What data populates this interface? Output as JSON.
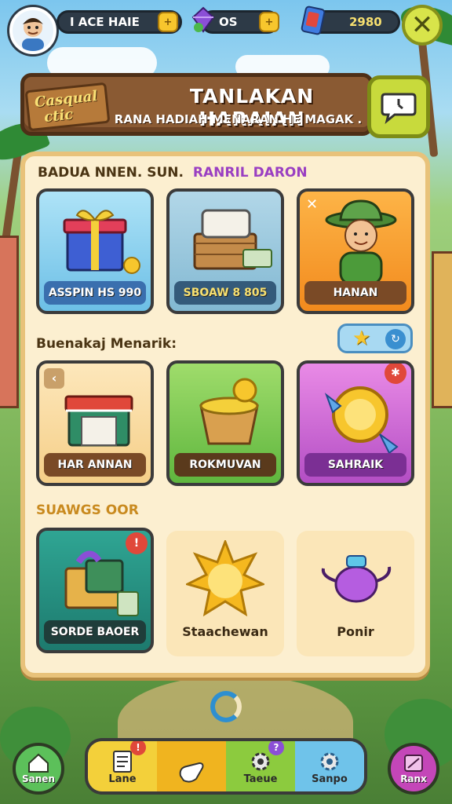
{
  "header": {
    "player_name": "I ACE HAIE",
    "gems": "OS",
    "currency": "2980",
    "coin_add_symbol": "+",
    "close_symbol": "✕"
  },
  "banner": {
    "logo_line1": "Casqual",
    "logo_line2": "ctic",
    "title": "TANLAKAN HARAIAN",
    "subtitle": "RANA HADIAH MENARAN HE MAGAK ."
  },
  "sections": {
    "daily_title_a": "BADUA NNEN. SUN.",
    "daily_title_b": "RANRIL DARON",
    "special_title": "Buenakaj Menarik:",
    "other_title": "SUAWGS OOR"
  },
  "cards_row1": [
    {
      "label": "ASSPIN HS 990"
    },
    {
      "label": "SBOAW 8 805"
    },
    {
      "label": "HANAN"
    }
  ],
  "cards_row2": [
    {
      "label": "HAR ANNAN"
    },
    {
      "label": "ROKMUVAN"
    },
    {
      "label": "SAHRAIK"
    }
  ],
  "cards_row3": [
    {
      "label": "SORDE BAOER",
      "badge": "!"
    },
    {
      "label": "Staachewan"
    },
    {
      "label": "Ponir"
    }
  ],
  "nav": {
    "left_button": "Sanen",
    "items": [
      {
        "label": "Lane",
        "badge": "!"
      },
      {
        "label": ""
      },
      {
        "label": "Taeue",
        "badge": "?"
      },
      {
        "label": "Sanpo"
      }
    ],
    "right_button": "Ranx"
  },
  "colors": {
    "panel_bg": "#fcefd0",
    "banner_wood": "#8a5a33",
    "accent_yellow": "#f7c62d",
    "close_green": "#d8e44a"
  }
}
